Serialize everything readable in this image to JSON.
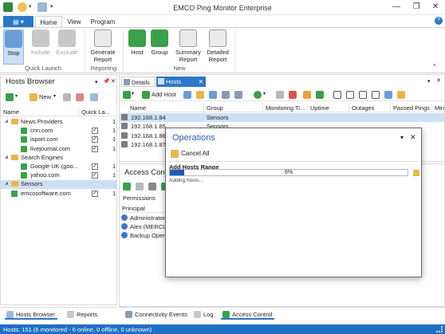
{
  "window": {
    "title": "EMCO Ping Monitor Enterprise",
    "controls": {
      "minimize": "—",
      "restore": "❐",
      "close": "✕"
    }
  },
  "ribbon": {
    "file_label": "▤ ▾",
    "tabs": [
      "Home",
      "View",
      "Program"
    ],
    "groups": {
      "quick_launch": "Quick Launch",
      "reporting": "Reporting",
      "new": "New"
    },
    "buttons": {
      "stop": "Stop",
      "include": "Include",
      "exclude": "Exclude",
      "generate_report": "Generate\nReport",
      "host": "Host",
      "group": "Group",
      "summary_report": "Summary\nReport",
      "detailed_report": "Detailed\nReport"
    },
    "collapse": "^",
    "help": "?"
  },
  "hosts_browser": {
    "title": "Hosts Browser",
    "new_label": "New",
    "columns": [
      "Name",
      "Quick La..."
    ],
    "tree": [
      {
        "label": "News Providers",
        "type": "folder",
        "level": 0
      },
      {
        "label": "cnn.com",
        "type": "host",
        "level": 1
      },
      {
        "label": "isport.com",
        "type": "host",
        "level": 1
      },
      {
        "label": "livejournal.com",
        "type": "host",
        "level": 1
      },
      {
        "label": "Search Engines",
        "type": "folder",
        "level": 0
      },
      {
        "label": "Google UK (goo...",
        "type": "host",
        "level": 1
      },
      {
        "label": "yahoo.com",
        "type": "host",
        "level": 1
      },
      {
        "label": "Sensors",
        "type": "folder",
        "level": 0
      },
      {
        "label": "emcosoftware.com",
        "type": "host",
        "level": 0
      }
    ],
    "quick_values": [
      "1",
      "1",
      "1",
      "1",
      "",
      "1",
      "1",
      "",
      "1"
    ]
  },
  "main_tabs": {
    "details": "Details",
    "hosts": "Hosts"
  },
  "hosts_table": {
    "add_host": "Add Host",
    "columns": [
      "Name",
      "Group",
      "Monitoring Ti...",
      "Uptime",
      "Outages",
      "Passed Pings",
      "Min"
    ],
    "rows": [
      {
        "name": "192.168.1.84",
        "group": "Sensors"
      },
      {
        "name": "192.168.1.85",
        "group": "Sensors"
      },
      {
        "name": "192.168.1.86",
        "group": "Sensors"
      },
      {
        "name": "192.168.1.87",
        "group": "Sensors"
      }
    ]
  },
  "access_control": {
    "title": "Access Control",
    "permissions_label": "Permissions",
    "principal_label": "Principal",
    "principals": [
      "Administrator",
      "Alex (MERCUR...",
      "Backup Opera..."
    ]
  },
  "bottom_tabs": {
    "left": [
      "Hosts Browser",
      "Reports"
    ],
    "right": [
      "Connectivity Events",
      "Log",
      "Access Control"
    ]
  },
  "status_bar": "Hosts: 151 (6 monitored - 6 online, 0 offline, 0 unknown)",
  "operations_dialog": {
    "title": "Operations",
    "cancel_all": "Cancel All",
    "op_title": "Add Hosts Range",
    "progress_text": "6%",
    "progress_value": 0.06,
    "sub_text": "Adding hosts..."
  },
  "colors": {
    "accent": "#2b78c8",
    "status_bar": "#1f6fc4",
    "progress": "#1f5bb8"
  }
}
